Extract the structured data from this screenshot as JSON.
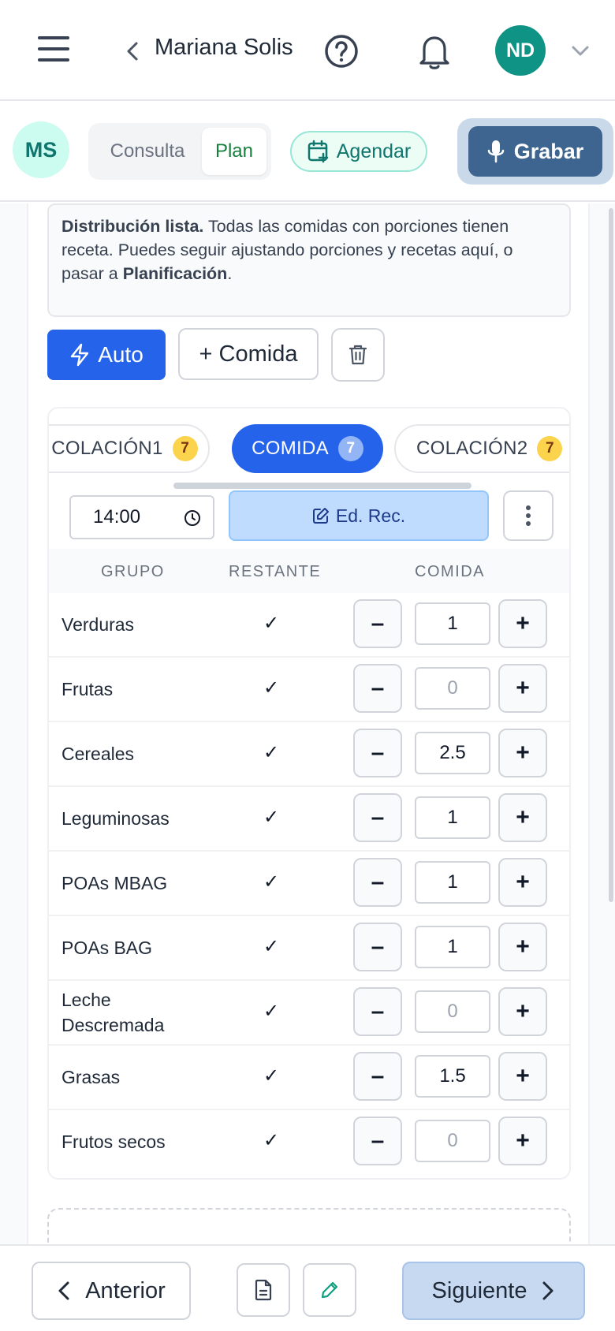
{
  "header": {
    "patient_name": "Mariana Solis",
    "user_initials": "ND",
    "icons": [
      "menu-icon",
      "chevron-left-icon",
      "help-icon",
      "bell-icon",
      "chevron-down-icon"
    ]
  },
  "subheader": {
    "patient_initials": "MS",
    "segment": {
      "consulta_label": "Consulta",
      "plan_label": "Plan",
      "selected": "Plan"
    },
    "agendar_label": "Agendar",
    "grabar_label": "Grabar"
  },
  "info": {
    "bold_lead": "Distribución lista.",
    "text": " Todas las comidas con porciones tienen receta. Puedes seguir ajustando porciones y recetas aquí, o pasar a ",
    "bold_tail": "Planificación",
    "end": "."
  },
  "actions": {
    "auto_label": "Auto",
    "add_meal_label": "+ Comida"
  },
  "meal_tabs": [
    {
      "label": "COLACIÓN1",
      "count": "7",
      "active": false
    },
    {
      "label": "COMIDA",
      "count": "7",
      "active": true
    },
    {
      "label": "COLACIÓN2",
      "count": "7",
      "active": false
    }
  ],
  "meal": {
    "time": "14:00",
    "edit_recipe_label": "Ed. Rec."
  },
  "table": {
    "headers": {
      "group": "GRUPO",
      "remaining": "RESTANTE",
      "meal": "COMIDA"
    },
    "rows": [
      {
        "group": "Verduras",
        "remaining": "✓",
        "qty": "1"
      },
      {
        "group": "Frutas",
        "remaining": "✓",
        "qty": "0"
      },
      {
        "group": "Cereales",
        "remaining": "✓",
        "qty": "2.5"
      },
      {
        "group": "Leguminosas",
        "remaining": "✓",
        "qty": "1"
      },
      {
        "group": "POAs MBAG",
        "remaining": "✓",
        "qty": "1"
      },
      {
        "group": "POAs BAG",
        "remaining": "✓",
        "qty": "1"
      },
      {
        "group_line1": "Leche",
        "group_line2": "Descremada",
        "remaining": "✓",
        "qty": "0"
      },
      {
        "group": "Grasas",
        "remaining": "✓",
        "qty": "1.5"
      },
      {
        "group": "Frutos secos",
        "remaining": "✓",
        "qty": "0"
      }
    ],
    "minus_label": "–",
    "plus_label": "+"
  },
  "footer": {
    "prev_label": "Anterior",
    "next_label": "Siguiente"
  },
  "colors": {
    "primary": "#2563eb",
    "teal": "#0e9384",
    "record": "#3d6590",
    "badge": "#fcd34d"
  }
}
